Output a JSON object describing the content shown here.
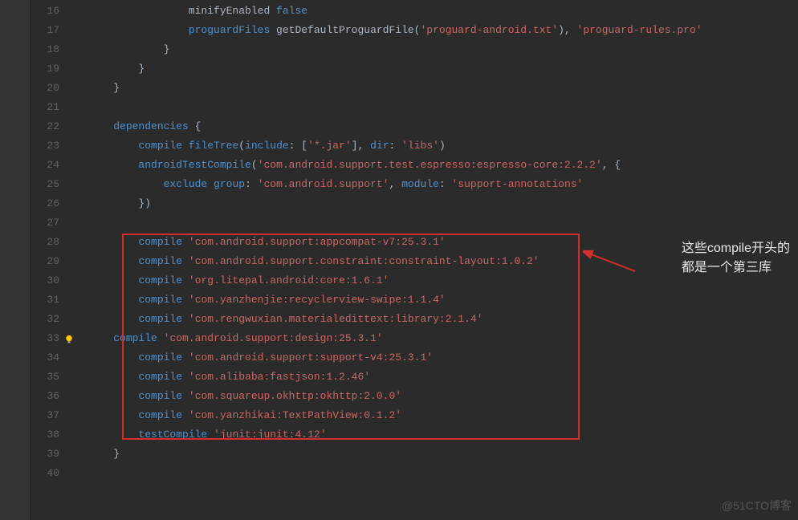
{
  "gutter": {
    "start": 16,
    "end": 40,
    "bulb_line": 33
  },
  "lines": {
    "16": [
      {
        "t": "                ",
        "c": ""
      },
      {
        "t": "minifyEnabled ",
        "c": ""
      },
      {
        "t": "false",
        "c": "kw-blue"
      }
    ],
    "17": [
      {
        "t": "                ",
        "c": ""
      },
      {
        "t": "proguardFiles ",
        "c": "kw-blue"
      },
      {
        "t": "getDefaultProguardFile(",
        "c": ""
      },
      {
        "t": "'proguard-android.txt'",
        "c": "str"
      },
      {
        "t": "), ",
        "c": ""
      },
      {
        "t": "'proguard-rules.pro'",
        "c": "str"
      }
    ],
    "18": [
      {
        "t": "            }",
        "c": ""
      }
    ],
    "19": [
      {
        "t": "        }",
        "c": ""
      }
    ],
    "20": [
      {
        "t": "    }",
        "c": ""
      }
    ],
    "21": [
      {
        "t": "",
        "c": ""
      }
    ],
    "22": [
      {
        "t": "    ",
        "c": ""
      },
      {
        "t": "dependencies ",
        "c": "kw-blue"
      },
      {
        "t": "{",
        "c": ""
      }
    ],
    "23": [
      {
        "t": "        ",
        "c": ""
      },
      {
        "t": "compile ",
        "c": "kw-blue"
      },
      {
        "t": "fileTree",
        "c": "kw-blue"
      },
      {
        "t": "(",
        "c": ""
      },
      {
        "t": "include",
        "c": "kw-blue"
      },
      {
        "t": ": [",
        "c": ""
      },
      {
        "t": "'*.jar'",
        "c": "str"
      },
      {
        "t": "], ",
        "c": ""
      },
      {
        "t": "dir",
        "c": "kw-blue"
      },
      {
        "t": ": ",
        "c": ""
      },
      {
        "t": "'libs'",
        "c": "str"
      },
      {
        "t": ")",
        "c": ""
      }
    ],
    "24": [
      {
        "t": "        ",
        "c": ""
      },
      {
        "t": "androidTestCompile",
        "c": "kw-blue"
      },
      {
        "t": "(",
        "c": ""
      },
      {
        "t": "'com.android.support.test.espresso:espresso-core:2.2.2'",
        "c": "str"
      },
      {
        "t": ", {",
        "c": ""
      }
    ],
    "25": [
      {
        "t": "            ",
        "c": ""
      },
      {
        "t": "exclude ",
        "c": "kw-blue"
      },
      {
        "t": "group",
        "c": "kw-blue"
      },
      {
        "t": ": ",
        "c": ""
      },
      {
        "t": "'com.android.support'",
        "c": "str"
      },
      {
        "t": ", ",
        "c": ""
      },
      {
        "t": "module",
        "c": "kw-blue"
      },
      {
        "t": ": ",
        "c": ""
      },
      {
        "t": "'support-annotations'",
        "c": "str"
      }
    ],
    "26": [
      {
        "t": "        })",
        "c": ""
      }
    ],
    "27": [
      {
        "t": "",
        "c": ""
      }
    ],
    "28": [
      {
        "t": "        ",
        "c": ""
      },
      {
        "t": "compile ",
        "c": "kw-blue"
      },
      {
        "t": "'com.android.support:appcompat-v7:25.3.1'",
        "c": "str"
      }
    ],
    "29": [
      {
        "t": "        ",
        "c": ""
      },
      {
        "t": "compile ",
        "c": "kw-blue"
      },
      {
        "t": "'com.android.support.constraint:constraint-layout:1.0.2'",
        "c": "str"
      }
    ],
    "30": [
      {
        "t": "        ",
        "c": ""
      },
      {
        "t": "compile ",
        "c": "kw-blue"
      },
      {
        "t": "'org.litepal.android:core:1.6.1'",
        "c": "str"
      }
    ],
    "31": [
      {
        "t": "        ",
        "c": ""
      },
      {
        "t": "compile ",
        "c": "kw-blue"
      },
      {
        "t": "'com.yanzhenjie:recyclerview-swipe:1.1.4'",
        "c": "str"
      }
    ],
    "32": [
      {
        "t": "        ",
        "c": ""
      },
      {
        "t": "compile ",
        "c": "kw-blue"
      },
      {
        "t": "'com.rengwuxian.materialedittext:library:2.1.4'",
        "c": "str"
      }
    ],
    "33": [
      {
        "t": "    ",
        "c": ""
      },
      {
        "t": "compile ",
        "c": "kw-blue"
      },
      {
        "t": "'com.android.support:design:25.3.1'",
        "c": "str"
      }
    ],
    "34": [
      {
        "t": "        ",
        "c": ""
      },
      {
        "t": "compile ",
        "c": "kw-blue"
      },
      {
        "t": "'com.android.support:support-v4:25.3.1'",
        "c": "str"
      }
    ],
    "35": [
      {
        "t": "        ",
        "c": ""
      },
      {
        "t": "compile ",
        "c": "kw-blue"
      },
      {
        "t": "'com.alibaba:fastjson:1.2.46'",
        "c": "str"
      }
    ],
    "36": [
      {
        "t": "        ",
        "c": ""
      },
      {
        "t": "compile ",
        "c": "kw-blue"
      },
      {
        "t": "'com.squareup.okhttp:okhttp:2.0.0'",
        "c": "str"
      }
    ],
    "37": [
      {
        "t": "        ",
        "c": ""
      },
      {
        "t": "compile ",
        "c": "kw-blue"
      },
      {
        "t": "'com.yanzhikai:TextPathView:0.1.2'",
        "c": "str"
      }
    ],
    "38": [
      {
        "t": "        ",
        "c": ""
      },
      {
        "t": "testCompile ",
        "c": "kw-blue"
      },
      {
        "t": "'junit:junit:4.12'",
        "c": "str"
      }
    ],
    "39": [
      {
        "t": "    }",
        "c": ""
      }
    ],
    "40": [
      {
        "t": "",
        "c": ""
      }
    ]
  },
  "annotation": {
    "line1": "这些compile开头的",
    "line2": "都是一个第三库"
  },
  "watermark": "@51CTO博客"
}
